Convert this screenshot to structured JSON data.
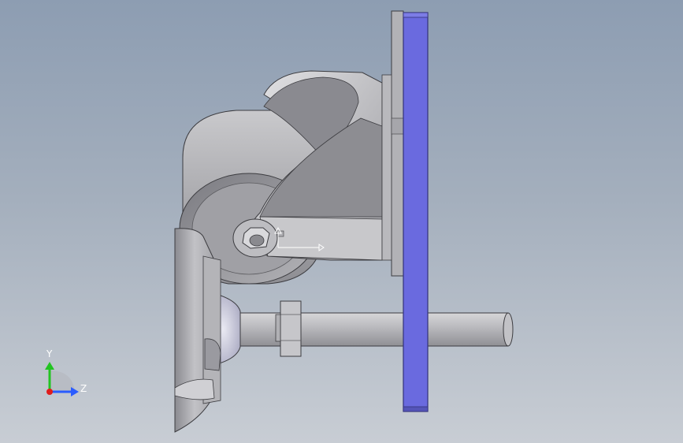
{
  "viewport": {
    "background_top": "#8d9db2",
    "background_bottom": "#c8cdd4"
  },
  "model": {
    "plate_color": "#6a6adf",
    "plate_edge_color": "#33337a",
    "metal_light": "#d8d8da",
    "metal_mid": "#a9a9ad",
    "metal_dark": "#6d6d72"
  },
  "triad": {
    "y_label": "Y",
    "z_label": "Z",
    "y_color": "#22c422",
    "z_color": "#2a5cff",
    "x_color": "#e01c1c"
  },
  "icons": {
    "origin": "origin-icon",
    "triad": "axis-triad-icon"
  }
}
